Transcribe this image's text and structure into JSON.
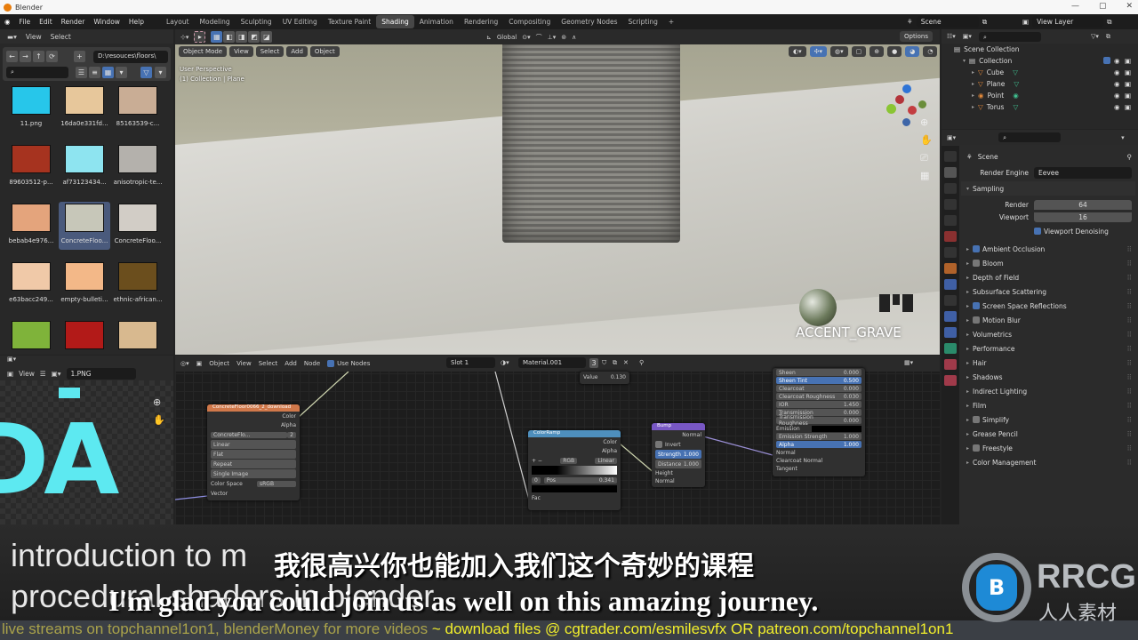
{
  "window": {
    "title": "Blender",
    "controls": [
      "—",
      "▢",
      "✕"
    ]
  },
  "menubar": {
    "menus": [
      "File",
      "Edit",
      "Render",
      "Window",
      "Help"
    ],
    "workspaces": [
      "Layout",
      "Modeling",
      "Sculpting",
      "UV Editing",
      "Texture Paint",
      "Shading",
      "Animation",
      "Rendering",
      "Compositing",
      "Geometry Nodes",
      "Scripting",
      "+"
    ],
    "active_workspace": "Shading",
    "scene": "Scene",
    "view_layer": "View Layer"
  },
  "file_browser": {
    "header": [
      "View",
      "Select"
    ],
    "path": "D:\\resouces\\floors\\",
    "search_placeholder": "",
    "files": [
      {
        "name": "11.png",
        "color": "#27c6ea"
      },
      {
        "name": "16da0e331fd...",
        "color": "#e7c79b"
      },
      {
        "name": "85163539-c...",
        "color": "#c9ad95"
      },
      {
        "name": "89603512-p...",
        "color": "#a6331f"
      },
      {
        "name": "af73123434...",
        "color": "#8ee4f0"
      },
      {
        "name": "anisotropic-te...",
        "color": "#b4b1ac"
      },
      {
        "name": "bebab4e976...",
        "color": "#e4a47c"
      },
      {
        "name": "ConcreteFloo...",
        "color": "#c7c7b9",
        "selected": true
      },
      {
        "name": "ConcreteFloo...",
        "color": "#d2cdc6"
      },
      {
        "name": "e63bacc249...",
        "color": "#f0c9a8"
      },
      {
        "name": "empty-bulleti...",
        "color": "#f3b888"
      },
      {
        "name": "ethnic-african...",
        "color": "#6b4e1d"
      },
      {
        "name": "",
        "color": "#7fb33a"
      },
      {
        "name": "",
        "color": "#b21a18"
      },
      {
        "name": "",
        "color": "#d8b98f"
      }
    ]
  },
  "image_editor": {
    "view_label": "View",
    "image_name": "1.PNG",
    "preview_text": "DA"
  },
  "viewport": {
    "header": {
      "orientation": "Global",
      "options": "Options"
    },
    "mode": "Object Mode",
    "menus": [
      "View",
      "Select",
      "Add",
      "Object"
    ],
    "overlay_title": "User Perspective",
    "overlay_sub": "(1) Collection | Plane",
    "keypress_text": "ACCENT_GRAVE"
  },
  "node_editor": {
    "mode": "Object",
    "menus": [
      "View",
      "Select",
      "Add",
      "Node"
    ],
    "use_nodes_label": "Use Nodes",
    "use_nodes": true,
    "slot": "Slot 1",
    "material": "Material.001",
    "users": "3",
    "value_node": {
      "label": "Value",
      "value": "0.130"
    },
    "image_node": {
      "title": "ConcreteFloor0066_2_download",
      "outputs": [
        "Color",
        "Alpha"
      ],
      "image": "ConcreteFlo...",
      "users": "2",
      "interpolation": "Linear",
      "projection": "Flat",
      "extension": "Repeat",
      "source": "Single Image",
      "color_space_label": "Color Space",
      "color_space": "sRGB",
      "input": "Vector"
    },
    "colorramp_node": {
      "title": "ColorRamp",
      "outputs": [
        "Color",
        "Alpha"
      ],
      "mode": "RGB",
      "interp": "Linear",
      "stop_index": "0",
      "pos_label": "Pos",
      "pos_value": "0.341",
      "input": "Fac"
    },
    "bump_node": {
      "title": "Bump",
      "output": "Normal",
      "invert": "Invert",
      "strength_label": "Strength",
      "strength": "1.000",
      "distance_label": "Distance",
      "distance": "1.000",
      "inputs": [
        "Height",
        "Normal"
      ]
    },
    "bsdf_rows": [
      {
        "label": "Sheen",
        "value": "0.000"
      },
      {
        "label": "Sheen Tint",
        "value": "0.500",
        "blue": true
      },
      {
        "label": "Clearcoat",
        "value": "0.000"
      },
      {
        "label": "Clearcoat Roughness",
        "value": "0.030"
      },
      {
        "label": "IOR",
        "value": "1.450"
      },
      {
        "label": "Transmission",
        "value": "0.000"
      },
      {
        "label": "Transmission Roughness",
        "value": "0.000"
      },
      {
        "label": "Emission",
        "value": ""
      },
      {
        "label": "Emission Strength",
        "value": "1.000"
      },
      {
        "label": "Alpha",
        "value": "1.000",
        "blue": true
      },
      {
        "label": "Normal",
        "value": ""
      },
      {
        "label": "Clearcoat Normal",
        "value": ""
      },
      {
        "label": "Tangent",
        "value": ""
      }
    ]
  },
  "outliner": {
    "root": "Scene Collection",
    "collection": "Collection",
    "items": [
      "Cube",
      "Plane",
      "Point",
      "Torus"
    ]
  },
  "properties": {
    "context": "Scene",
    "render_engine_label": "Render Engine",
    "render_engine": "Eevee",
    "sampling_label": "Sampling",
    "render_label": "Render",
    "render_samples": "64",
    "viewport_label": "Viewport",
    "viewport_samples": "16",
    "denoise_label": "Viewport Denoising",
    "panels": [
      {
        "label": "Ambient Occlusion",
        "checkbox": true,
        "checked": true
      },
      {
        "label": "Bloom",
        "checkbox": true,
        "checked": false
      },
      {
        "label": "Depth of Field",
        "checkbox": false
      },
      {
        "label": "Subsurface Scattering",
        "checkbox": false
      },
      {
        "label": "Screen Space Reflections",
        "checkbox": true,
        "checked": true
      },
      {
        "label": "Motion Blur",
        "checkbox": true,
        "checked": false
      },
      {
        "label": "Volumetrics",
        "checkbox": false
      },
      {
        "label": "Performance",
        "checkbox": false
      },
      {
        "label": "Hair",
        "checkbox": false
      },
      {
        "label": "Shadows",
        "checkbox": false
      },
      {
        "label": "Indirect Lighting",
        "checkbox": false
      },
      {
        "label": "Film",
        "checkbox": false
      },
      {
        "label": "Simplify",
        "checkbox": true,
        "checked": false
      },
      {
        "label": "Grease Pencil",
        "checkbox": false
      },
      {
        "label": "Freestyle",
        "checkbox": true,
        "checked": false
      },
      {
        "label": "Color Management",
        "checkbox": false
      }
    ]
  },
  "subtitles": {
    "bg_line1": "introduction to m",
    "bg_line2": "procedural shaders in blender",
    "chinese": "我很高兴你也能加入我们这个奇妙的课程",
    "english": "I'm glad you could join us as well on this amazing journey.",
    "ticker_left": "live streams on topchannel1on1,  blenderMoney for more videos",
    "ticker_right": " ~ download files @ cgtrader.com/esmilesvfx OR patreon.com/topchannel1on1"
  },
  "watermark": {
    "brand": "RRCG",
    "sub": "人人素材"
  }
}
